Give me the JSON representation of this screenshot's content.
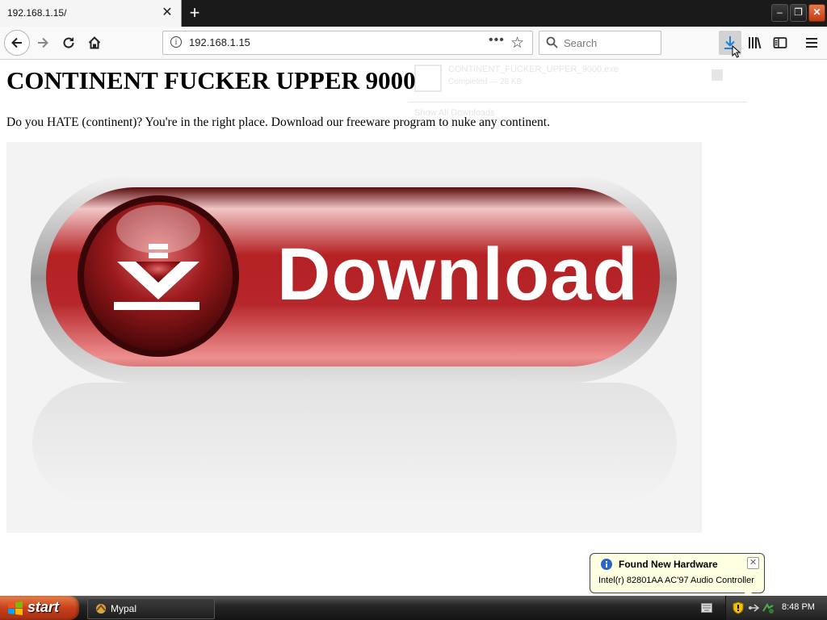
{
  "browser": {
    "tab_title": "192.168.1.15/",
    "url": "192.168.1.15",
    "search_placeholder": "Search"
  },
  "download_panel": {
    "file_name": "CONTINENT_FUCKER_UPPER_9000.exe",
    "status": "Completed — 28 KB",
    "footer": "Show All Downloads"
  },
  "page": {
    "title": "CONTINENT FUCKER UPPER 9000",
    "description": "Do you HATE (continent)? You're in the right place. Download our freeware program to nuke any continent.",
    "button_text": "Download"
  },
  "taskbar": {
    "start_label": "start",
    "task_label": "Mypal",
    "clock": "8:48 PM"
  },
  "notification": {
    "title": "Found New Hardware",
    "message": "Intel(r) 82801AA AC'97 Audio Controller"
  },
  "colors": {
    "download_red": "#c7282c",
    "download_accent": "#1e7fd6",
    "balloon_bg": "#ffffe1"
  }
}
